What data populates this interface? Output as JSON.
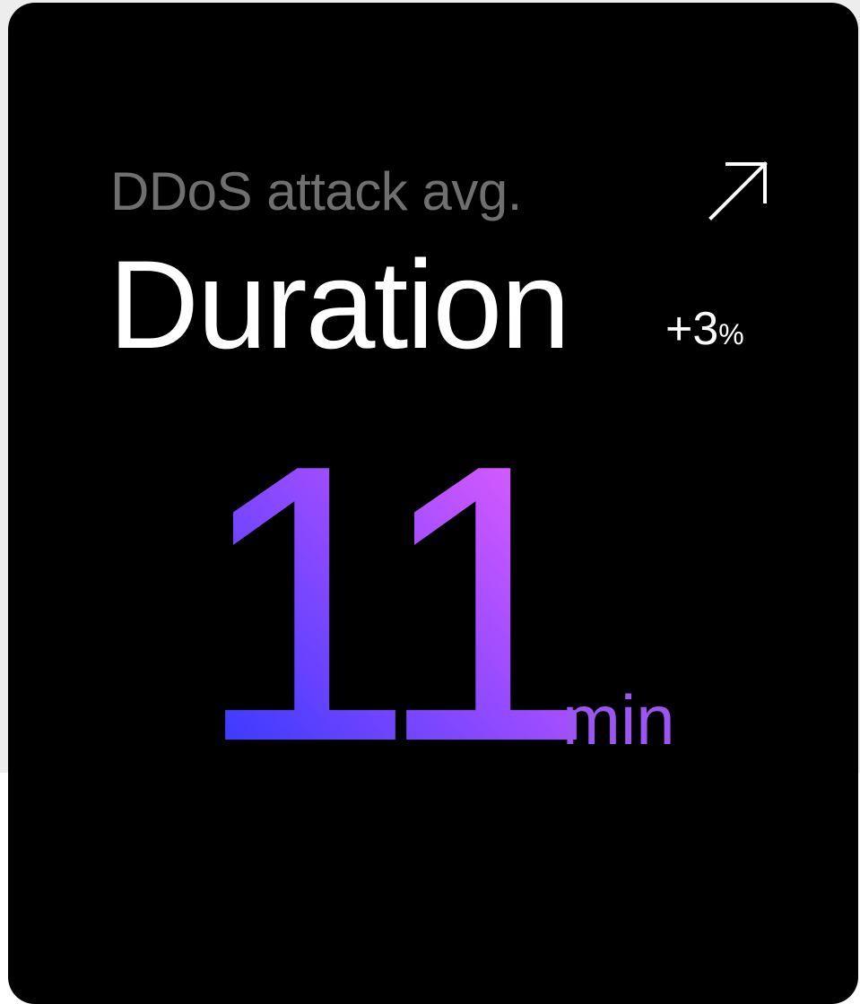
{
  "card": {
    "subtitle": "DDoS attack avg.",
    "title": "Duration",
    "change": {
      "value": "+3",
      "unit": "%"
    },
    "metric": {
      "value": "11",
      "unit": "min"
    },
    "open_icon": "arrow-up-right-icon"
  },
  "colors": {
    "background": "#000000",
    "subtitle": "#6f6f6f",
    "title": "#ffffff",
    "gradient_start": "#1f35ff",
    "gradient_mid": "#9a4cff",
    "gradient_end": "#ff63ff",
    "unit": "#9b55f3"
  }
}
